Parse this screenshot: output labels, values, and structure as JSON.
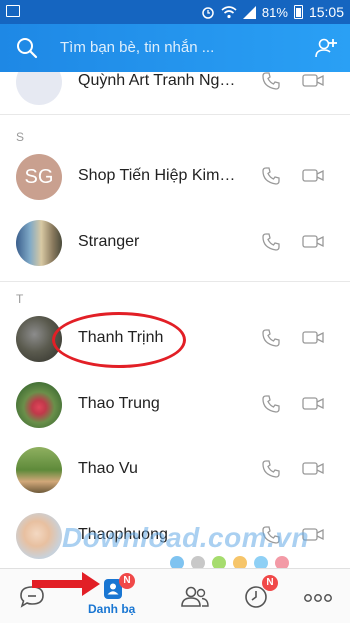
{
  "status_bar": {
    "battery": "81%",
    "time": "15:05"
  },
  "header": {
    "search_placeholder": "Tìm bạn bè, tin nhắn ..."
  },
  "sections": {
    "s": "S",
    "t": "T"
  },
  "contacts": [
    {
      "name": "Quỳnh Art Tranh Ngọc Đá Quý",
      "avatar_type": "blank"
    },
    {
      "name": "Shop Tiến Hiệp Kim Khí Điện Máy",
      "avatar_type": "initials",
      "initials": "SG"
    },
    {
      "name": "Stranger",
      "avatar_type": "photo"
    },
    {
      "name": "Thanh Trịnh",
      "avatar_type": "photo"
    },
    {
      "name": "Thao Trung",
      "avatar_type": "photo"
    },
    {
      "name": "Thao Vu",
      "avatar_type": "photo"
    },
    {
      "name": "Thaophuong",
      "avatar_type": "photo"
    }
  ],
  "watermark": {
    "text": "Download.com.vn"
  },
  "bottom_nav": {
    "contacts_label": "Danh bạ",
    "contacts_badge": "N",
    "timeline_badge": "N"
  },
  "colors": {
    "header_start": "#1e88e5",
    "header_end": "#2aa0f5",
    "active_nav": "#1976d2",
    "badge": "#f04848",
    "annotation_red": "#e21f26"
  },
  "icons": {
    "status_left": "gallery-icon",
    "search": "search-icon",
    "add_friend": "add-friend-icon",
    "call": "phone-icon",
    "video": "video-call-icon",
    "nav_messages": "chat-icon",
    "nav_contacts": "contact-book-icon",
    "nav_groups": "group-icon",
    "nav_timeline": "clock-icon",
    "nav_more": "more-icon"
  }
}
